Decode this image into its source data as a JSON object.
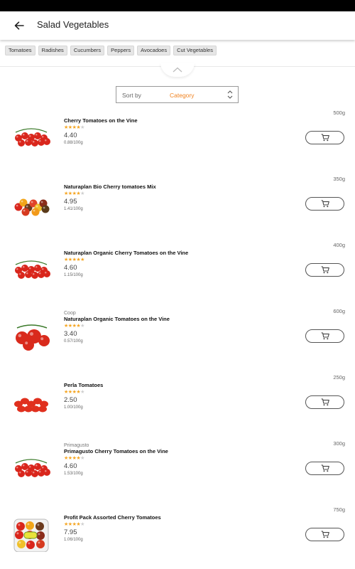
{
  "app_bar": {
    "title": "Salad Vegetables",
    "back_icon": "arrow-left-icon"
  },
  "categories": [
    "Tomatoes",
    "Radishes",
    "Cucumbers",
    "Peppers",
    "Avocadoes",
    "Cut Vegetables"
  ],
  "sort": {
    "label": "Sort by",
    "value": "Category"
  },
  "colors": {
    "accent": "#f0821e",
    "star": "#f5a623",
    "star_empty": "#cfcfcf"
  },
  "products": [
    {
      "brand": "",
      "name": "Cherry Tomatoes on the Vine",
      "rating": 4,
      "price": "4.40",
      "unit_price": "0.88/100g",
      "weight": "500g",
      "image": "cherry-vine"
    },
    {
      "brand": "",
      "name": "Naturaplan Bio  Cherry tomatoes Mix",
      "rating": 4,
      "price": "4.95",
      "unit_price": "1.41/100g",
      "weight": "350g",
      "image": "mix"
    },
    {
      "brand": "",
      "name": "Naturaplan Organic Cherry Tomatoes on the Vine",
      "rating": 5,
      "price": "4.60",
      "unit_price": "1.15/100g",
      "weight": "400g",
      "image": "cherry-vine"
    },
    {
      "brand": "Coop",
      "name": "Naturaplan Organic Tomatoes on the Vine",
      "rating": 4,
      "price": "3.40",
      "unit_price": "0.57/100g",
      "weight": "600g",
      "image": "big-vine"
    },
    {
      "brand": "",
      "name": "Perla Tomatoes",
      "rating": 4,
      "price": "2.50",
      "unit_price": "1.00/100g",
      "weight": "250g",
      "image": "perla"
    },
    {
      "brand": "Primagusto",
      "name": "Primagusto Cherry Tomatoes on the Vine",
      "rating": 4,
      "price": "4.60",
      "unit_price": "1.53/100g",
      "weight": "300g",
      "image": "cherry-vine"
    },
    {
      "brand": "",
      "name": "Profit Pack Assorted Cherry Tomatoes",
      "rating": 4,
      "price": "7.95",
      "unit_price": "1.06/100g",
      "weight": "750g",
      "image": "pack"
    }
  ]
}
